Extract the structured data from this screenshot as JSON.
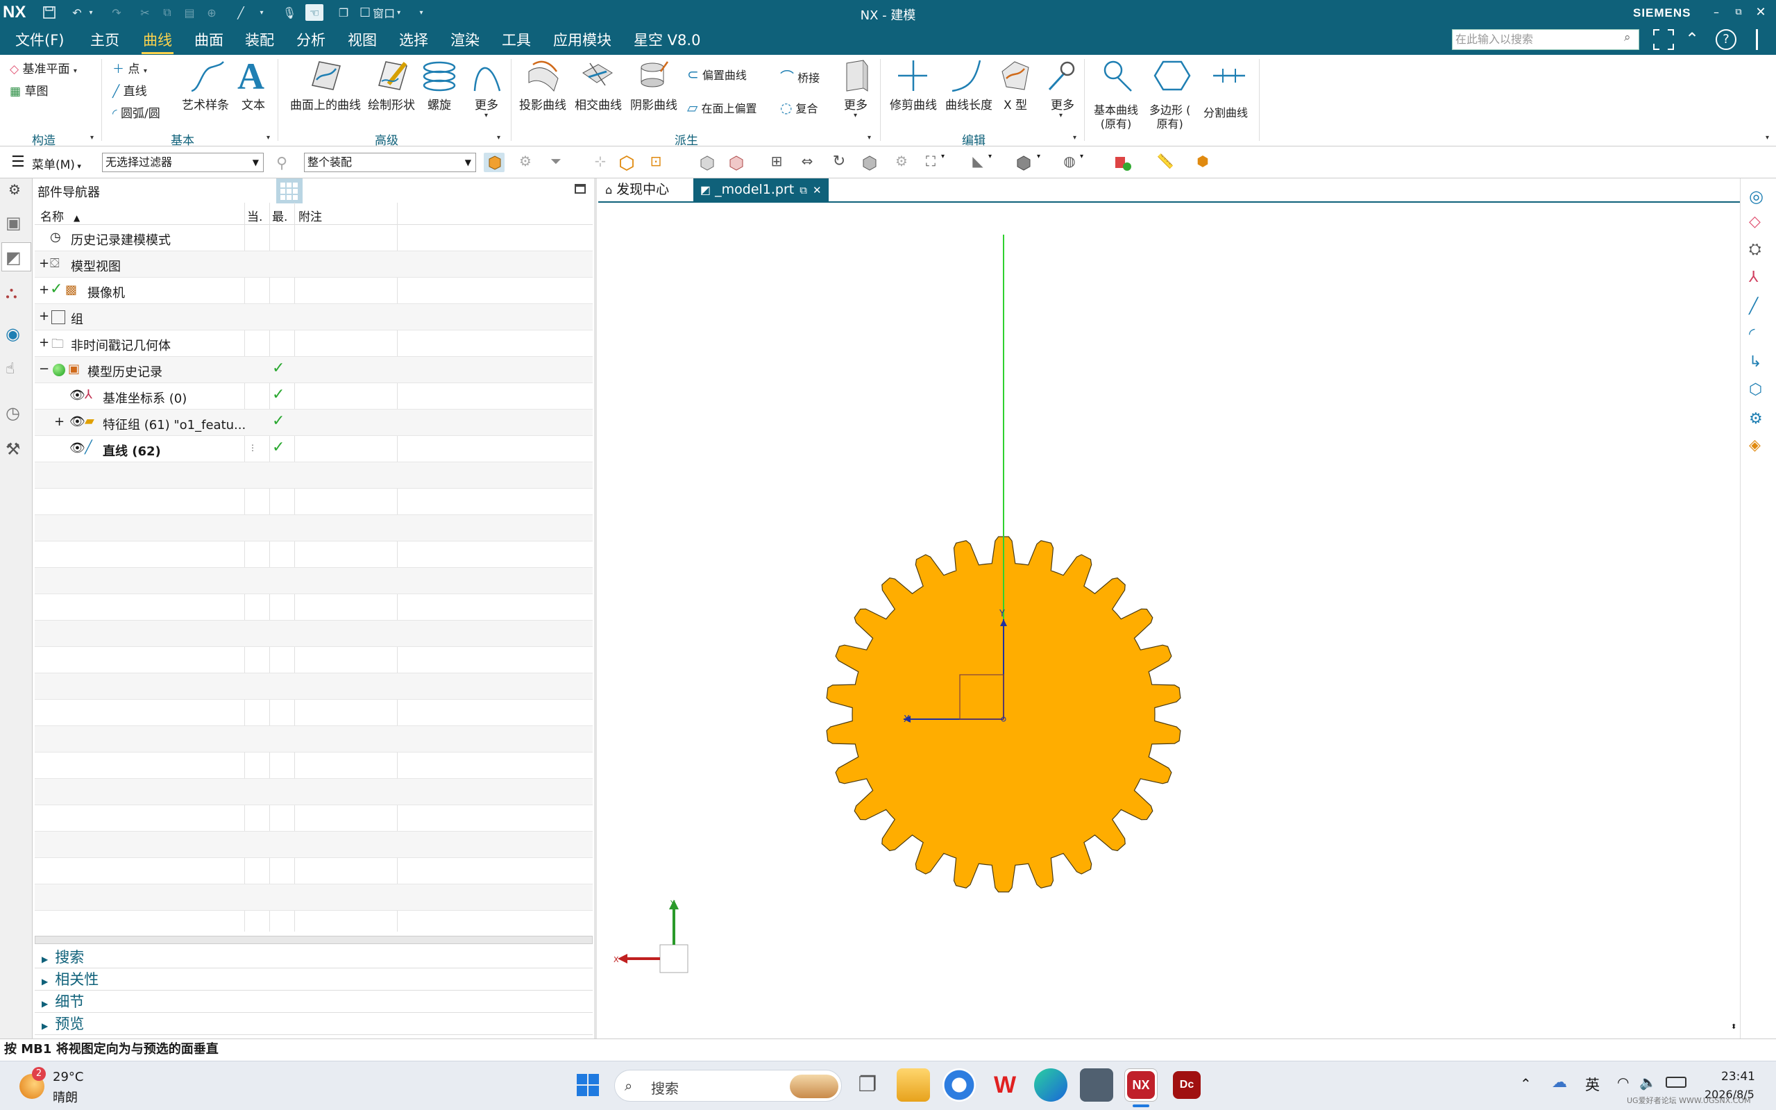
{
  "title_bar": {
    "logo": "NX",
    "window_title": "NX - 建模",
    "brand": "SIEMENS",
    "window_menu_label": "窗口",
    "controls": [
      "minimize-icon",
      "restore-icon",
      "close-icon"
    ]
  },
  "menu_bar": {
    "items": [
      "文件(F)",
      "主页",
      "曲线",
      "曲面",
      "装配",
      "分析",
      "视图",
      "选择",
      "渲染",
      "工具",
      "应用模块",
      "星空 V8.0"
    ],
    "active": "曲线",
    "search_placeholder": "在此输入以搜索"
  },
  "ribbon": {
    "construct": {
      "items": [
        "基准平面",
        "草图"
      ],
      "group": "构造"
    },
    "basic": {
      "items": [
        "点",
        "直线",
        "圆弧/圆",
        "艺术样条",
        "文本"
      ],
      "group": "基本"
    },
    "advanced": {
      "items": [
        "曲面上的曲线",
        "绘制形状",
        "螺旋",
        "更多"
      ],
      "group": "高级"
    },
    "derived": {
      "items": [
        "投影曲线",
        "相交曲线",
        "阴影曲线",
        "偏置曲线",
        "在面上偏置",
        "桥接",
        "复合",
        "更多"
      ],
      "group": "派生"
    },
    "edit": {
      "items": [
        "修剪曲线",
        "曲线长度",
        "X 型",
        "更多"
      ],
      "group": "编辑"
    },
    "extra": {
      "items": [
        "基本曲线\n(原有)",
        "多边形 (\n原有)",
        "分割曲线"
      ]
    }
  },
  "toolbar": {
    "menu_label": "菜单(M)",
    "filter_value": "无选择过滤器",
    "scope_value": "整个装配"
  },
  "navigator": {
    "title": "部件导航器",
    "columns": [
      "名称",
      "当.",
      "最.",
      "附注"
    ],
    "rows": [
      {
        "label": "历史记录建模模式",
        "expander": "",
        "check": false
      },
      {
        "label": "模型视图",
        "expander": "+",
        "check": false
      },
      {
        "label": "摄像机",
        "expander": "+",
        "check": false
      },
      {
        "label": "组",
        "expander": "+",
        "check": false
      },
      {
        "label": "非时间戳记几何体",
        "expander": "+",
        "check": false
      },
      {
        "label": "模型历史记录",
        "expander": "−",
        "check": true
      },
      {
        "label": "基准坐标系 (0)",
        "expander": "",
        "check": true
      },
      {
        "label": "特征组 (61) \"o1_featu...",
        "expander": "+",
        "check": true
      },
      {
        "label": "直线 (62)",
        "expander": "",
        "check": true
      }
    ],
    "sections": [
      "搜索",
      "相关性",
      "细节",
      "预览"
    ]
  },
  "tabs": [
    {
      "label": "发现中心",
      "active": false
    },
    {
      "label": "_model1.prt",
      "active": true
    }
  ],
  "viewport": {
    "gear_color": "#ffad00",
    "line_color": "#2fd12f",
    "triad": {
      "x": "X",
      "y": "Y"
    }
  },
  "status_text": "按 MB1 将视图定向为与预选的面垂直",
  "taskbar": {
    "weather_temp": "29°C",
    "weather_desc": "晴朗",
    "weather_badge": "2",
    "search_label": "搜索",
    "ime": "英",
    "time": "23:41",
    "date": "2026/8/5",
    "watermark": "UG爱好者论坛 WWW.UGSNX.COM"
  }
}
